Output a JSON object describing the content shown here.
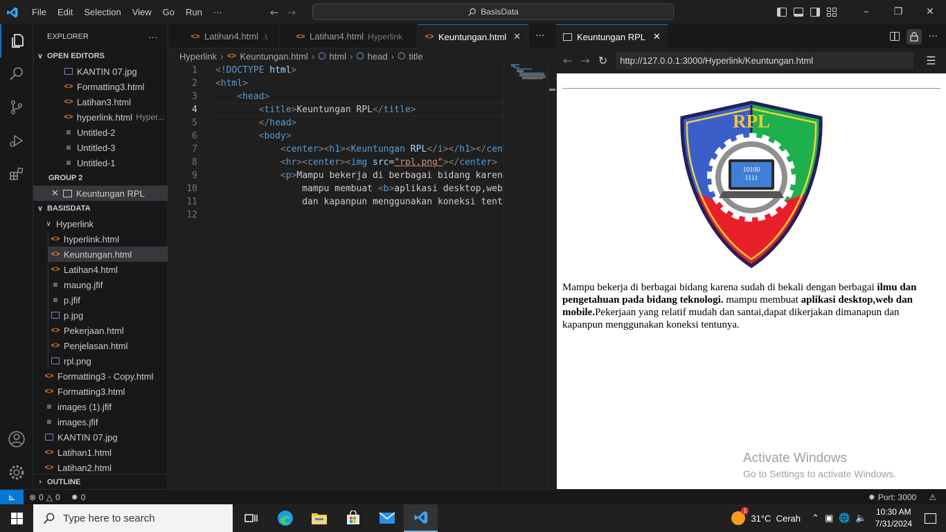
{
  "titlebar": {
    "menus": [
      "File",
      "Edit",
      "Selection",
      "View",
      "Go",
      "Run",
      "···"
    ],
    "search": "BasisData"
  },
  "explorer": {
    "title": "EXPLORER",
    "more": "···",
    "open_editors_label": "OPEN EDITORS",
    "open_editors": [
      {
        "name": "KANTIN 07.jpg",
        "type": "img",
        "desc": ""
      },
      {
        "name": "Formatting3.html",
        "type": "html",
        "desc": ""
      },
      {
        "name": "Latihan3.html",
        "type": "html",
        "desc": ""
      },
      {
        "name": "hyperlink.html",
        "type": "html",
        "desc": "Hyper..."
      },
      {
        "name": "Untitled-2",
        "type": "txt",
        "desc": ""
      },
      {
        "name": "Untitled-3",
        "type": "txt",
        "desc": ""
      },
      {
        "name": "Untitled-1",
        "type": "txt",
        "desc": ""
      }
    ],
    "group2_label": "GROUP 2",
    "group2_item": "Keuntungan RPL",
    "workspace_label": "BASISDATA",
    "folder": "Hyperlink",
    "folder_files": [
      {
        "name": "hyperlink.html",
        "type": "html"
      },
      {
        "name": "Keuntungan.html",
        "type": "html"
      },
      {
        "name": "Latihan4.html",
        "type": "html"
      },
      {
        "name": "maung.jfif",
        "type": "txt"
      },
      {
        "name": "p.jfif",
        "type": "txt"
      },
      {
        "name": "p.jpg",
        "type": "img"
      },
      {
        "name": "Pekerjaan.html",
        "type": "html"
      },
      {
        "name": "Penjelasan.html",
        "type": "html"
      },
      {
        "name": "rpl.png",
        "type": "img"
      }
    ],
    "root_files": [
      {
        "name": "Formatting3 - Copy.html",
        "type": "html"
      },
      {
        "name": "Formatting3.html",
        "type": "html"
      },
      {
        "name": "images (1).jfif",
        "type": "txt"
      },
      {
        "name": "images.jfif",
        "type": "txt"
      },
      {
        "name": "KANTIN 07.jpg",
        "type": "img"
      },
      {
        "name": "Latihan1.html",
        "type": "html"
      },
      {
        "name": "Latihan2.html",
        "type": "html"
      }
    ],
    "outline_label": "OUTLINE"
  },
  "tabs": [
    {
      "label": "Latihan4.html",
      "desc": ".\\"
    },
    {
      "label": "Latihan4.html",
      "desc": "Hyperlink"
    },
    {
      "label": "Keuntungan.html",
      "desc": ""
    }
  ],
  "tabs_more": "···",
  "breadcrumb": [
    "Hyperlink",
    "Keuntungan.html",
    "html",
    "head",
    "title"
  ],
  "line_numbers": [
    "1",
    "2",
    "3",
    "4",
    "5",
    "6",
    "7",
    "8",
    "9",
    "10",
    "11",
    "12"
  ],
  "preview": {
    "tab_title": "Keuntungan RPL",
    "url": "http://127.0.0.1:3000/Hyperlink/Keuntungan.html",
    "logo_text": "RPL",
    "logo_binary_1": "10100",
    "logo_binary_2": "1111",
    "para": {
      "p1": "Mampu bekerja di berbagai bidang karena sudah di bekali dengan berbagai ",
      "b1": "ilmu dan pengetahuan pada bidang teknologi.",
      "p2": " mampu membuat ",
      "b2": "aplikasi desktop,web dan mobile.",
      "p3": "Pekerjaan yang relatif mudah dan santai,dapat dikerjakan dimanapun dan kapanpun menggunakan koneksi tentunya."
    }
  },
  "watermark": {
    "line1": "Activate Windows",
    "line2": "Go to Settings to activate Windows."
  },
  "status": {
    "errors": "0",
    "warnings": "0",
    "ports_count": "0",
    "port": "Port: 3000"
  },
  "taskbar": {
    "search_placeholder": "Type here to search",
    "weather": "31°C  Cerah",
    "weather_badge": "1",
    "time": "10:30 AM",
    "date": "7/31/2024"
  },
  "colors": {
    "accent": "#0078d4",
    "html_icon": "#e37933",
    "image_icon": "#a074c4"
  }
}
